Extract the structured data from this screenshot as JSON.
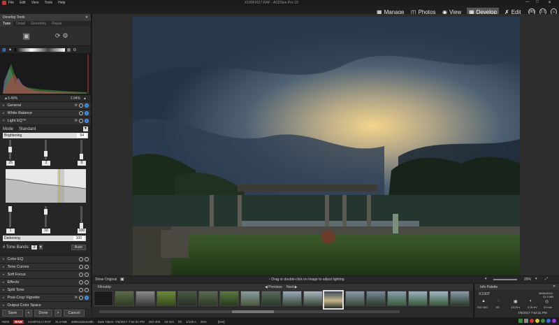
{
  "app": {
    "title": "X100F0117.RAF - ACDSee Pro 10"
  },
  "menu": [
    "File",
    "Edit",
    "View",
    "Tools",
    "Help"
  ],
  "modes": {
    "manage": "Manage",
    "photos": "Photos",
    "view": "View",
    "develop": "Develop",
    "edit": "Edit",
    "round1": "365",
    "round2": "1:1"
  },
  "panel": {
    "title": "Develop Tools",
    "tabs": [
      "Tune",
      "Detail",
      "Geometry",
      "Repair"
    ],
    "histo_left": "0.49%",
    "histo_right": "2.94%",
    "sections_top": [
      "General",
      "White Balance"
    ],
    "lighteq": {
      "label": "Light EQ™",
      "mode_label": "Mode",
      "mode_value": "Standard",
      "bright_label": "Brightening",
      "bright_value": "54",
      "v1": "25",
      "v2": "2",
      "v3": "0",
      "w1": "1",
      "w2": "16",
      "w3": "100",
      "dark_label": "Darkening",
      "dark_value": "100",
      "tone_label": "# Tone Bands:",
      "tone_value": "3",
      "auto": "Auto"
    },
    "sections_bottom": [
      "Color EQ",
      "Tone Curves",
      "Soft Focus",
      "Effects",
      "Split Tone",
      "Post-Crop Vignette",
      "Output Color Space"
    ]
  },
  "buttons": {
    "save": "Save",
    "done": "Done",
    "cancel": "Cancel"
  },
  "infobar": {
    "show_original": "Show Original",
    "hint": "Drag or double-click on image to adjust lighting.",
    "zoom": "26%"
  },
  "filmstrip": {
    "title": "Filmstrip",
    "previous": "Previous",
    "next": "Next"
  },
  "infopalette": {
    "title": "Info Palette",
    "camera": "X100T",
    "dims": "4896x3264",
    "size": "31.9 MB",
    "iso": "ISO 400",
    "fstop": "f/6",
    "shutter": "1/125 s",
    "ev": "0.00 eV",
    "focal": "23 mm",
    "date": "7/6/2017 7:52:31 PM"
  },
  "status": {
    "index": "76/90",
    "raw": "RAW",
    "file": "X100F0117.RAF",
    "size": "31.9 MB",
    "dims": "4896x3264x48b",
    "date": "Date Taken: 7/6/2017 7:52:31 PM",
    "iso": "ISO 400",
    "focal": "23 mm",
    "fstop": "f/6",
    "shutter": "1/125 s",
    "zoom": "26%",
    "res": "[0x0]"
  },
  "colors": {
    "accent": "#2a7fd4",
    "raw": "#aa3333"
  }
}
